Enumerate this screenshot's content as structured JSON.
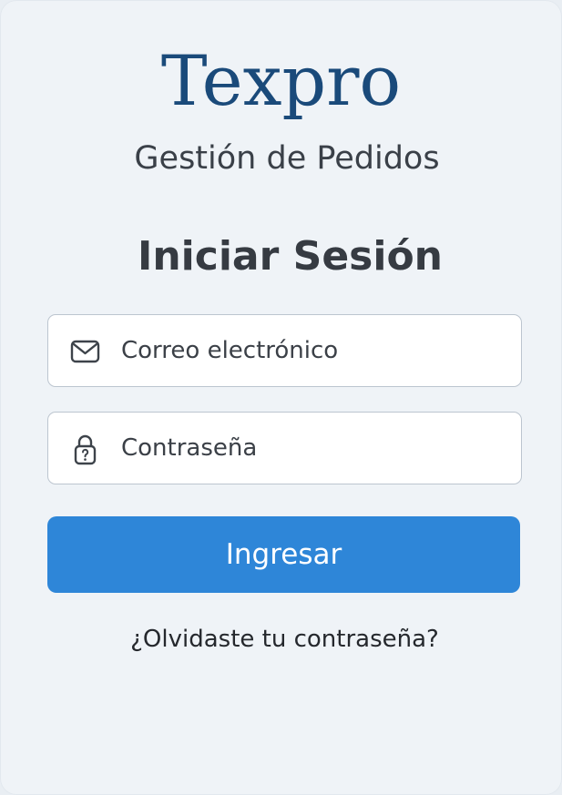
{
  "brand": {
    "name": "Texpro",
    "color": "#1a4a7a"
  },
  "subtitle": "Gestión de Pedidos",
  "login": {
    "heading": "Iniciar Sesión",
    "email": {
      "placeholder": "Correo electrónico",
      "value": "",
      "icon": "envelope-icon"
    },
    "password": {
      "placeholder": "Contraseña",
      "value": "",
      "icon": "lock-icon"
    },
    "submit_label": "Ingresar",
    "submit_color": "#2e86d8",
    "forgot_label": "¿Olvidaste tu contraseña?"
  }
}
